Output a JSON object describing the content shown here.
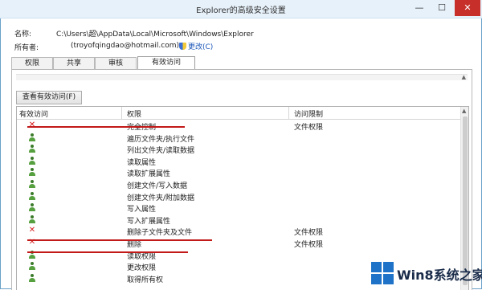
{
  "window": {
    "title": "Explorer的高级安全设置",
    "minimize": "—",
    "maximize": "☐",
    "close": "✕"
  },
  "info": {
    "name_label": "名称:",
    "name_value": "C:\\Users\\超\\AppData\\Local\\Microsoft\\Windows\\Explorer",
    "owner_label": "所有者:",
    "owner_value": "(troyofqingdao@hotmail.com)",
    "change_link": "更改(C)"
  },
  "tabs": [
    {
      "label": "权限"
    },
    {
      "label": "共享"
    },
    {
      "label": "审核"
    },
    {
      "label": "有效访问"
    }
  ],
  "active_tab": "有效访问",
  "view_button": "查看有效访问(F)",
  "table": {
    "headers": [
      "有效访问",
      "权限",
      "访问限制"
    ],
    "rows": [
      {
        "icon": "deny-x-icon",
        "permission": "完全控制",
        "limit": "文件权限"
      },
      {
        "icon": "user-allow-icon",
        "permission": "遍历文件夹/执行文件",
        "limit": ""
      },
      {
        "icon": "user-allow-icon",
        "permission": "列出文件夹/读取数据",
        "limit": ""
      },
      {
        "icon": "user-allow-icon",
        "permission": "读取属性",
        "limit": ""
      },
      {
        "icon": "user-allow-icon",
        "permission": "读取扩展属性",
        "limit": ""
      },
      {
        "icon": "user-allow-icon",
        "permission": "创建文件/写入数据",
        "limit": ""
      },
      {
        "icon": "user-allow-icon",
        "permission": "创建文件夹/附加数据",
        "limit": ""
      },
      {
        "icon": "user-allow-icon",
        "permission": "写入属性",
        "limit": ""
      },
      {
        "icon": "user-allow-icon",
        "permission": "写入扩展属性",
        "limit": ""
      },
      {
        "icon": "deny-x-icon",
        "permission": "删除子文件夹及文件",
        "limit": "文件权限"
      },
      {
        "icon": "deny-x-icon",
        "permission": "删除",
        "limit": "文件权限"
      },
      {
        "icon": "user-allow-icon",
        "permission": "读取权限",
        "limit": ""
      },
      {
        "icon": "user-allow-icon",
        "permission": "更改权限",
        "limit": ""
      },
      {
        "icon": "user-allow-icon",
        "permission": "取得所有权",
        "limit": ""
      }
    ]
  },
  "watermark": "Win8系统之家",
  "colors": {
    "deny": "#d62020",
    "annotation_line": "#c21919",
    "link": "#1a56b8",
    "close_button": "#c7302a"
  }
}
